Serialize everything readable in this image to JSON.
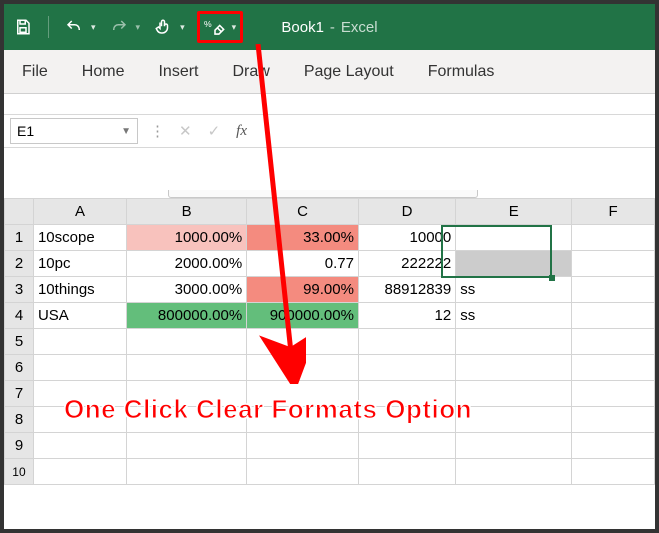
{
  "title": {
    "book": "Book1",
    "sep": "-",
    "app": "Excel"
  },
  "ribbon": {
    "tabs": [
      "File",
      "Home",
      "Insert",
      "Draw",
      "Page Layout",
      "Formulas"
    ]
  },
  "namebox": {
    "value": "E1"
  },
  "fx": {
    "label": "fx"
  },
  "columns": [
    "A",
    "B",
    "C",
    "D",
    "E",
    "F"
  ],
  "rows": [
    "1",
    "2",
    "3",
    "4",
    "5",
    "6",
    "7",
    "8",
    "9",
    "10"
  ],
  "data": {
    "A": [
      "10scope",
      "10pc",
      "10things",
      "USA"
    ],
    "B": [
      "1000.00%",
      "2000.00%",
      "3000.00%",
      "800000.00%"
    ],
    "C": [
      "33.00%",
      "0.77",
      "99.00%",
      "900000.00%"
    ],
    "D": [
      "10000",
      "222222",
      "88912839",
      "12"
    ],
    "E": [
      "",
      "",
      "ss",
      "ss"
    ]
  },
  "callout": "One Click Clear Formats Option",
  "chart_data": {
    "type": "table",
    "title": "Excel worksheet data (Book1)",
    "columns": [
      "A",
      "B",
      "C",
      "D",
      "E"
    ],
    "rows": [
      {
        "A": "10scope",
        "B": "1000.00%",
        "C": "33.00%",
        "D": 10000,
        "E": ""
      },
      {
        "A": "10pc",
        "B": "2000.00%",
        "C": "0.77",
        "D": 222222,
        "E": ""
      },
      {
        "A": "10things",
        "B": "3000.00%",
        "C": "99.00%",
        "D": 88912839,
        "E": "ss"
      },
      {
        "A": "USA",
        "B": "800000.00%",
        "C": "900000.00%",
        "D": 12,
        "E": "ss"
      }
    ],
    "selected_cell": "E1",
    "conditional_formatting": {
      "B1": "light-red",
      "B4": "green",
      "C1": "med-red",
      "C3": "med-red",
      "C4": "green"
    }
  }
}
